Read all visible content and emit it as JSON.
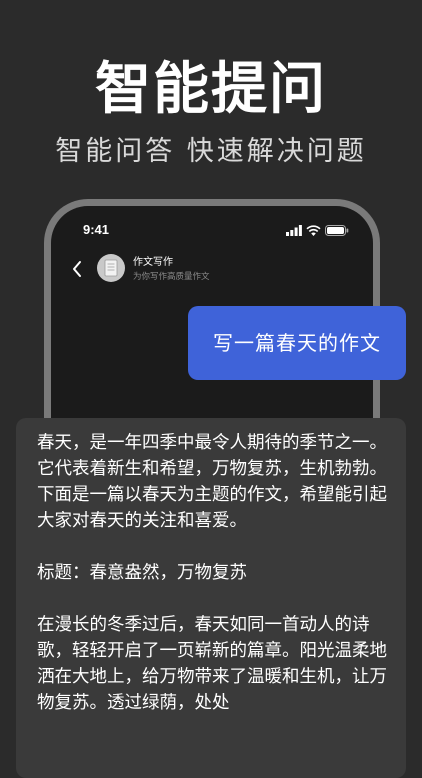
{
  "hero": {
    "title": "智能提问",
    "subtitle": "智能问答 快速解决问题"
  },
  "phone": {
    "status_time": "9:41",
    "status_icons": [
      "signal-icon",
      "wifi-icon",
      "battery-icon"
    ],
    "header": {
      "back_icon": "chevron-left-icon",
      "title": "作文写作",
      "subtitle": "为你写作高质量作文"
    }
  },
  "chat": {
    "user_message": "写一篇春天的作文",
    "answer": {
      "p1": "春天，是一年四季中最令人期待的季节之一。它代表着新生和希望，万物复苏，生机勃勃。下面是一篇以春天为主题的作文，希望能引起大家对春天的关注和喜爱。",
      "p2": "标题：春意盎然，万物复苏",
      "p3": "在漫长的冬季过后，春天如同一首动人的诗歌，轻轻开启了一页崭新的篇章。阳光温柔地洒在大地上，给万物带来了温暖和生机，让万物复苏。透过绿荫，处处"
    }
  },
  "colors": {
    "background": "#2b2b2b",
    "bubble": "#3f63d9",
    "card": "#3a3a3a",
    "phone_frame": "#7a7a7a"
  }
}
